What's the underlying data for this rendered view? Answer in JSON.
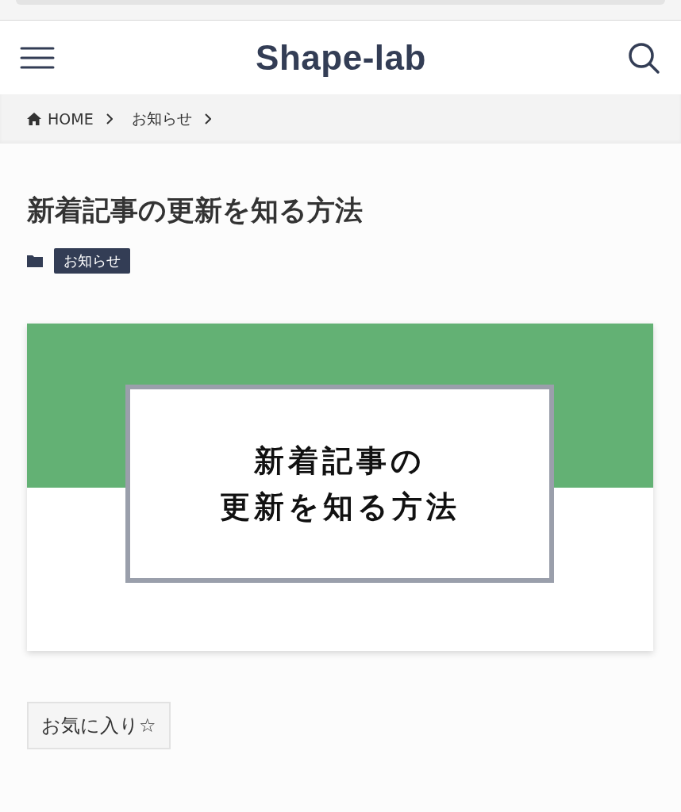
{
  "header": {
    "site_title": "Shape-lab"
  },
  "breadcrumb": [
    {
      "label": "HOME",
      "kind": "home"
    },
    {
      "label": "お知らせ",
      "kind": "page"
    }
  ],
  "article": {
    "title": "新着記事の更新を知る方法",
    "category": "お知らせ",
    "eyecatch": {
      "lines": [
        "新着記事の",
        "更新を知る方法"
      ]
    },
    "favorite_button": "お気に入り☆"
  }
}
